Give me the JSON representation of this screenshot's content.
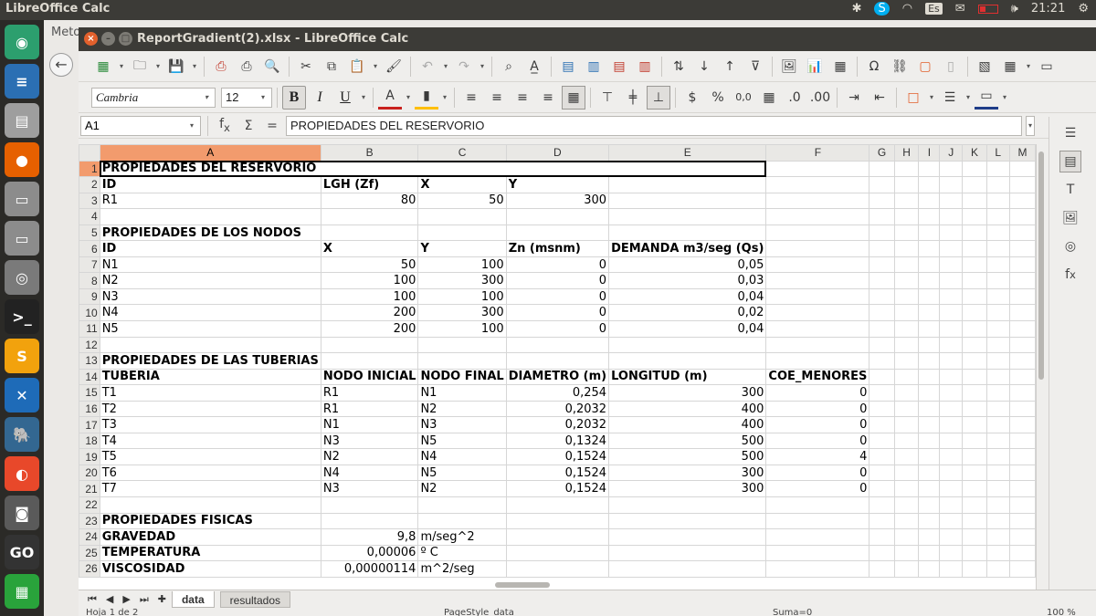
{
  "topbar": {
    "app_title": "LibreOffice Calc",
    "keyboard": "Es",
    "clock": "21:21"
  },
  "bg_window": {
    "tab_label": "Meto"
  },
  "window": {
    "title": "ReportGradient(2).xlsx - LibreOffice Calc"
  },
  "format": {
    "font_name": "Cambria",
    "font_size": "12",
    "bold": "B",
    "italic": "I",
    "underline": "U",
    "currency": "$",
    "percent": "%",
    "decimal": "0,0"
  },
  "formula_bar": {
    "cell_ref": "A1",
    "content": "PROPIEDADES DEL RESERVORIO"
  },
  "columns": [
    "A",
    "B",
    "C",
    "D",
    "E",
    "F",
    "G",
    "H",
    "I",
    "J",
    "K",
    "L",
    "M"
  ],
  "rows": [
    {
      "n": "1",
      "c": [
        "PROPIEDADES DEL RESERVORIO",
        "",
        "",
        "",
        "",
        "",
        "",
        "",
        "",
        "",
        "",
        "",
        ""
      ]
    },
    {
      "n": "2",
      "c": [
        "ID",
        "LGH (Zf)",
        "X",
        "Y",
        "",
        "",
        "",
        "",
        "",
        "",
        "",
        "",
        ""
      ]
    },
    {
      "n": "3",
      "c": [
        "R1",
        "80",
        "50",
        "300",
        "",
        "",
        "",
        "",
        "",
        "",
        "",
        "",
        ""
      ]
    },
    {
      "n": "4",
      "c": [
        "",
        "",
        "",
        "",
        "",
        "",
        "",
        "",
        "",
        "",
        "",
        "",
        ""
      ]
    },
    {
      "n": "5",
      "c": [
        "PROPIEDADES DE LOS NODOS",
        "",
        "",
        "",
        "",
        "",
        "",
        "",
        "",
        "",
        "",
        "",
        ""
      ]
    },
    {
      "n": "6",
      "c": [
        "ID",
        "X",
        "Y",
        "Zn (msnm)",
        "DEMANDA m3/seg (Qs)",
        "",
        "",
        "",
        "",
        "",
        "",
        "",
        ""
      ]
    },
    {
      "n": "7",
      "c": [
        "N1",
        "50",
        "100",
        "0",
        "0,05",
        "",
        "",
        "",
        "",
        "",
        "",
        "",
        ""
      ]
    },
    {
      "n": "8",
      "c": [
        "N2",
        "100",
        "300",
        "0",
        "0,03",
        "",
        "",
        "",
        "",
        "",
        "",
        "",
        ""
      ]
    },
    {
      "n": "9",
      "c": [
        "N3",
        "100",
        "100",
        "0",
        "0,04",
        "",
        "",
        "",
        "",
        "",
        "",
        "",
        ""
      ]
    },
    {
      "n": "10",
      "c": [
        "N4",
        "200",
        "300",
        "0",
        "0,02",
        "",
        "",
        "",
        "",
        "",
        "",
        "",
        ""
      ]
    },
    {
      "n": "11",
      "c": [
        "N5",
        "200",
        "100",
        "0",
        "0,04",
        "",
        "",
        "",
        "",
        "",
        "",
        "",
        ""
      ]
    },
    {
      "n": "12",
      "c": [
        "",
        "",
        "",
        "",
        "",
        "",
        "",
        "",
        "",
        "",
        "",
        "",
        ""
      ]
    },
    {
      "n": "13",
      "c": [
        "PROPIEDADES DE LAS TUBERIAS",
        "",
        "",
        "",
        "",
        "",
        "",
        "",
        "",
        "",
        "",
        "",
        ""
      ]
    },
    {
      "n": "14",
      "c": [
        "TUBERIA",
        "NODO INICIAL",
        "NODO FINAL",
        "DIAMETRO (m)",
        "LONGITUD (m)",
        "COE_MENORES",
        "",
        "",
        "",
        "",
        "",
        "",
        ""
      ]
    },
    {
      "n": "15",
      "c": [
        "T1",
        "R1",
        "N1",
        "0,254",
        "300",
        "0",
        "",
        "",
        "",
        "",
        "",
        "",
        ""
      ]
    },
    {
      "n": "16",
      "c": [
        "T2",
        "R1",
        "N2",
        "0,2032",
        "400",
        "0",
        "",
        "",
        "",
        "",
        "",
        "",
        ""
      ]
    },
    {
      "n": "17",
      "c": [
        "T3",
        "N1",
        "N3",
        "0,2032",
        "400",
        "0",
        "",
        "",
        "",
        "",
        "",
        "",
        ""
      ]
    },
    {
      "n": "18",
      "c": [
        "T4",
        "N3",
        "N5",
        "0,1324",
        "500",
        "0",
        "",
        "",
        "",
        "",
        "",
        "",
        ""
      ]
    },
    {
      "n": "19",
      "c": [
        "T5",
        "N2",
        "N4",
        "0,1524",
        "500",
        "4",
        "",
        "",
        "",
        "",
        "",
        "",
        ""
      ]
    },
    {
      "n": "20",
      "c": [
        "T6",
        "N4",
        "N5",
        "0,1524",
        "300",
        "0",
        "",
        "",
        "",
        "",
        "",
        "",
        ""
      ]
    },
    {
      "n": "21",
      "c": [
        "T7",
        "N3",
        "N2",
        "0,1524",
        "300",
        "0",
        "",
        "",
        "",
        "",
        "",
        "",
        ""
      ]
    },
    {
      "n": "22",
      "c": [
        "",
        "",
        "",
        "",
        "",
        "",
        "",
        "",
        "",
        "",
        "",
        "",
        ""
      ]
    },
    {
      "n": "23",
      "c": [
        "PROPIEDADES FISICAS",
        "",
        "",
        "",
        "",
        "",
        "",
        "",
        "",
        "",
        "",
        "",
        ""
      ]
    },
    {
      "n": "24",
      "c": [
        "GRAVEDAD",
        "9,8",
        "m/seg^2",
        "",
        "",
        "",
        "",
        "",
        "",
        "",
        "",
        "",
        ""
      ]
    },
    {
      "n": "25",
      "c": [
        "TEMPERATURA",
        "0,00006",
        "º C",
        "",
        "",
        "",
        "",
        "",
        "",
        "",
        "",
        "",
        ""
      ]
    },
    {
      "n": "26",
      "c": [
        "VISCOSIDAD",
        "0,00000114",
        "m^2/seg",
        "",
        "",
        "",
        "",
        "",
        "",
        "",
        "",
        "",
        ""
      ]
    }
  ],
  "sheet_tabs": [
    "data",
    "resultados"
  ],
  "status": {
    "sheet_info": "Hoja 1 de 2",
    "page_style": "PageStyle_data",
    "sum": "Suma=0",
    "zoom": "100 %"
  }
}
